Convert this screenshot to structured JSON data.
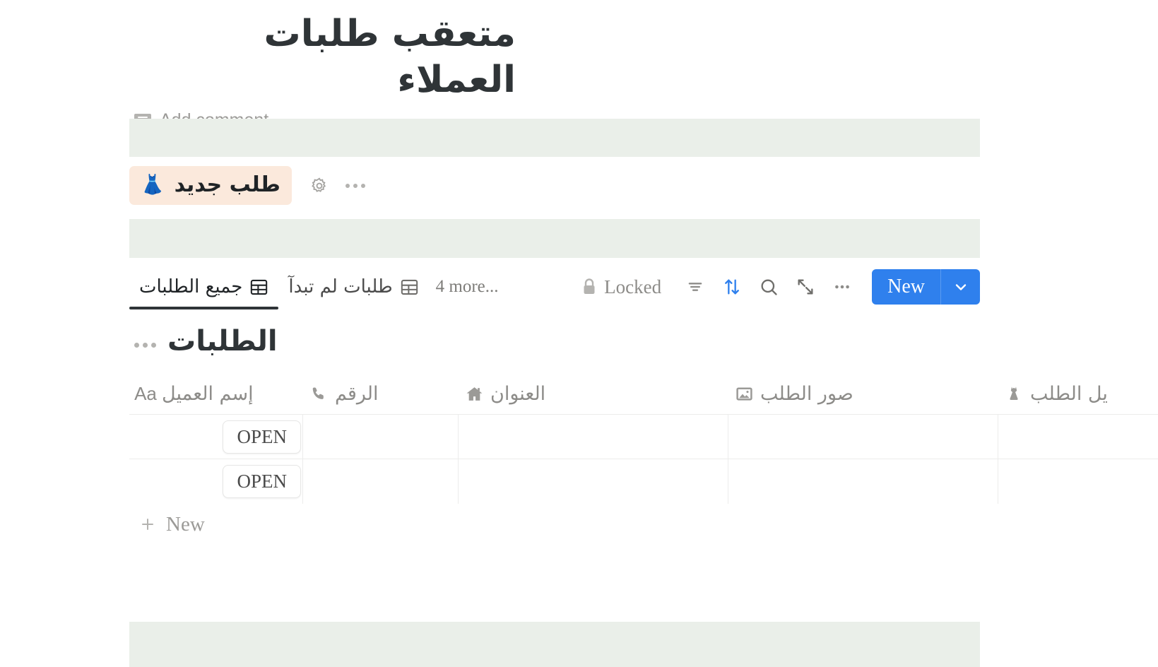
{
  "header": {
    "title": "متعقب طلبات العملاء",
    "add_comment_label": "Add comment",
    "comment_icon": "comment-bubble-icon"
  },
  "order_button": {
    "label": "طلب جديد",
    "emoji": "👗",
    "bg_color": "#fbe9dc",
    "gear_icon": "gear-icon",
    "more_icon": "ellipsis-icon"
  },
  "callouts": {
    "band_color": "#eaefe9"
  },
  "view_bar": {
    "tabs": [
      {
        "label": "جميع الطلبات",
        "icon": "table-icon",
        "active": true
      },
      {
        "label": "طلبات لم تبدآ",
        "icon": "table-icon",
        "active": false
      }
    ],
    "more_views": "4 more...",
    "locked_label": "Locked",
    "lock_icon": "lock-icon",
    "tools": [
      {
        "name": "filter-icon",
        "color": "#8d8c89"
      },
      {
        "name": "sort-icon",
        "color": "#2f80ed"
      },
      {
        "name": "search-icon",
        "color": "#6f6e6b"
      },
      {
        "name": "expand-icon",
        "color": "#6f6e6b"
      },
      {
        "name": "ellipsis-icon",
        "color": "#8d8c89"
      }
    ],
    "new_button": {
      "label": "New",
      "color": "#2f80ed",
      "caret_icon": "chevron-down-icon"
    }
  },
  "section": {
    "title": "الطلبات",
    "more_icon": "ellipsis-icon"
  },
  "table": {
    "columns": [
      {
        "label": "إسم العميل",
        "icon": "aa-text-icon"
      },
      {
        "label": "الرقم",
        "icon": "phone-icon"
      },
      {
        "label": "العنوان",
        "icon": "house-icon"
      },
      {
        "label": "صور الطلب",
        "icon": "image-icon"
      },
      {
        "label": "يل الطلب",
        "icon": "dress-icon"
      }
    ],
    "rows": [
      {
        "open_label": "OPEN",
        "name": "",
        "number": "",
        "address": "",
        "images": "",
        "details": ""
      },
      {
        "open_label": "OPEN",
        "name": "",
        "number": "",
        "address": "",
        "images": "",
        "details": ""
      }
    ],
    "new_row_label": "New",
    "new_row_icon": "plus-icon"
  }
}
